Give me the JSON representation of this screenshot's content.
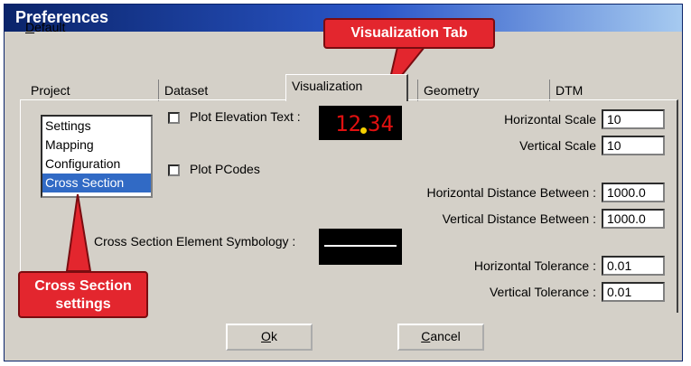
{
  "window": {
    "title": "Preferences"
  },
  "menubar": {
    "default_label": "Default",
    "default_mnemonic": "D",
    "default_rest": "efault"
  },
  "tabs": [
    {
      "label": "Project"
    },
    {
      "label": "Dataset"
    },
    {
      "label": "Visualization"
    },
    {
      "label": "Geometry"
    },
    {
      "label": "DTM"
    }
  ],
  "active_tab": "Visualization",
  "settings_list": {
    "items": [
      "Settings",
      "Mapping",
      "Configuration",
      "Cross Section"
    ],
    "selected": "Cross Section"
  },
  "visualization": {
    "plot_elevation_text": {
      "label": "Plot Elevation Text :",
      "checked": false
    },
    "elevation_preview": {
      "whole": "12",
      "decimal": "34",
      "text_color": "#e01010",
      "dot_color": "#f5d000"
    },
    "plot_pcodes": {
      "label": "Plot PCodes",
      "checked": false
    },
    "symbology_label": "Cross Section Element Symbology :",
    "horizontal_scale": {
      "label": "Horizontal Scale",
      "value": "10"
    },
    "vertical_scale": {
      "label": "Vertical Scale",
      "value": "10"
    },
    "horizontal_distance": {
      "label": "Horizontal Distance Between :",
      "value": "1000.0"
    },
    "vertical_distance": {
      "label": "Vertical Distance Between :",
      "value": "1000.0"
    },
    "horizontal_tolerance": {
      "label": "Horizontal Tolerance :",
      "value": "0.01"
    },
    "vertical_tolerance": {
      "label": "Vertical Tolerance :",
      "value": "0.01"
    }
  },
  "buttons": {
    "ok": {
      "mnemonic": "O",
      "rest": "k"
    },
    "cancel": {
      "mnemonic": "C",
      "rest": "ancel"
    }
  },
  "callouts": {
    "visualization_tab": "Visualization Tab",
    "cross_section_line1": "Cross Section",
    "cross_section_line2": "settings"
  },
  "colors": {
    "callout_red": "#e3262e",
    "selection_blue": "#316ac5",
    "dialog_gray": "#d4d0c8"
  }
}
